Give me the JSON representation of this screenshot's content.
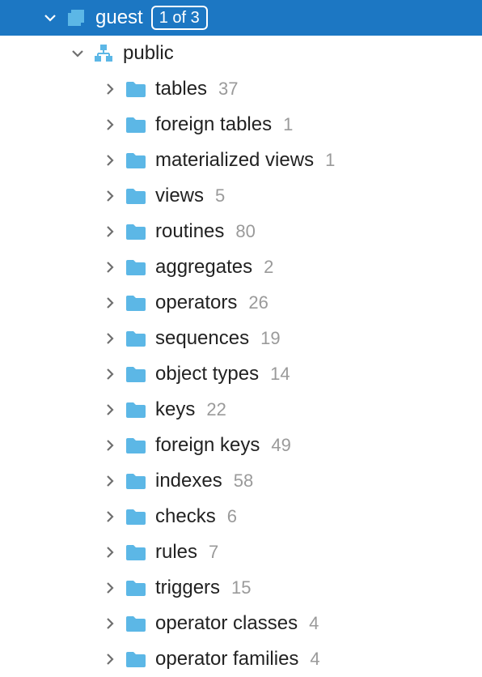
{
  "header": {
    "label": "guest",
    "badge": "1 of 3"
  },
  "schema": {
    "label": "public"
  },
  "items": [
    {
      "label": "tables",
      "count": "37"
    },
    {
      "label": "foreign tables",
      "count": "1"
    },
    {
      "label": "materialized views",
      "count": "1"
    },
    {
      "label": "views",
      "count": "5"
    },
    {
      "label": "routines",
      "count": "80"
    },
    {
      "label": "aggregates",
      "count": "2"
    },
    {
      "label": "operators",
      "count": "26"
    },
    {
      "label": "sequences",
      "count": "19"
    },
    {
      "label": "object types",
      "count": "14"
    },
    {
      "label": "keys",
      "count": "22"
    },
    {
      "label": "foreign keys",
      "count": "49"
    },
    {
      "label": "indexes",
      "count": "58"
    },
    {
      "label": "checks",
      "count": "6"
    },
    {
      "label": "rules",
      "count": "7"
    },
    {
      "label": "triggers",
      "count": "15"
    },
    {
      "label": "operator classes",
      "count": "4"
    },
    {
      "label": "operator families",
      "count": "4"
    }
  ]
}
